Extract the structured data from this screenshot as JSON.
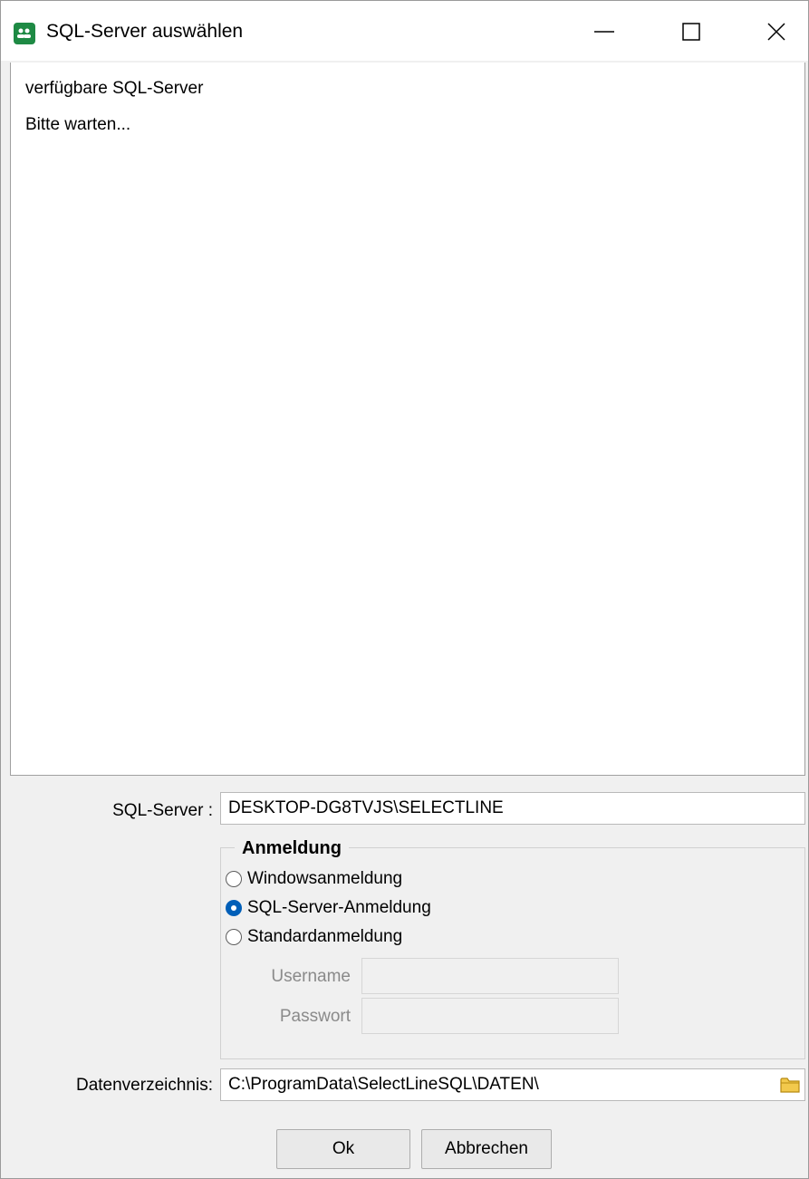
{
  "window": {
    "title": "SQL-Server auswählen",
    "icon": "app-users-icon",
    "controls": {
      "minimize": "minimize-icon",
      "maximize": "maximize-icon",
      "close": "close-icon"
    }
  },
  "server_list": {
    "header": "verfügbare SQL-Server",
    "status": "Bitte warten..."
  },
  "form": {
    "sql_server_label": "SQL-Server :",
    "sql_server_value": "DESKTOP-DG8TVJS\\SELECTLINE",
    "login_group": {
      "title": "Anmeldung",
      "options": [
        {
          "label": "Windowsanmeldung",
          "checked": false
        },
        {
          "label": "SQL-Server-Anmeldung",
          "checked": true
        },
        {
          "label": "Standardanmeldung",
          "checked": false
        }
      ],
      "username_label": "Username",
      "username_value": "",
      "password_label": "Passwort",
      "password_value": ""
    },
    "data_dir_label": "Datenverzeichnis:",
    "data_dir_value": "C:\\ProgramData\\SelectLineSQL\\DATEN\\"
  },
  "buttons": {
    "ok": "Ok",
    "cancel": "Abbrechen"
  },
  "colors": {
    "accent": "#005fb8",
    "app_icon": "#1e8a44",
    "folder_icon": "#f2c94c"
  }
}
